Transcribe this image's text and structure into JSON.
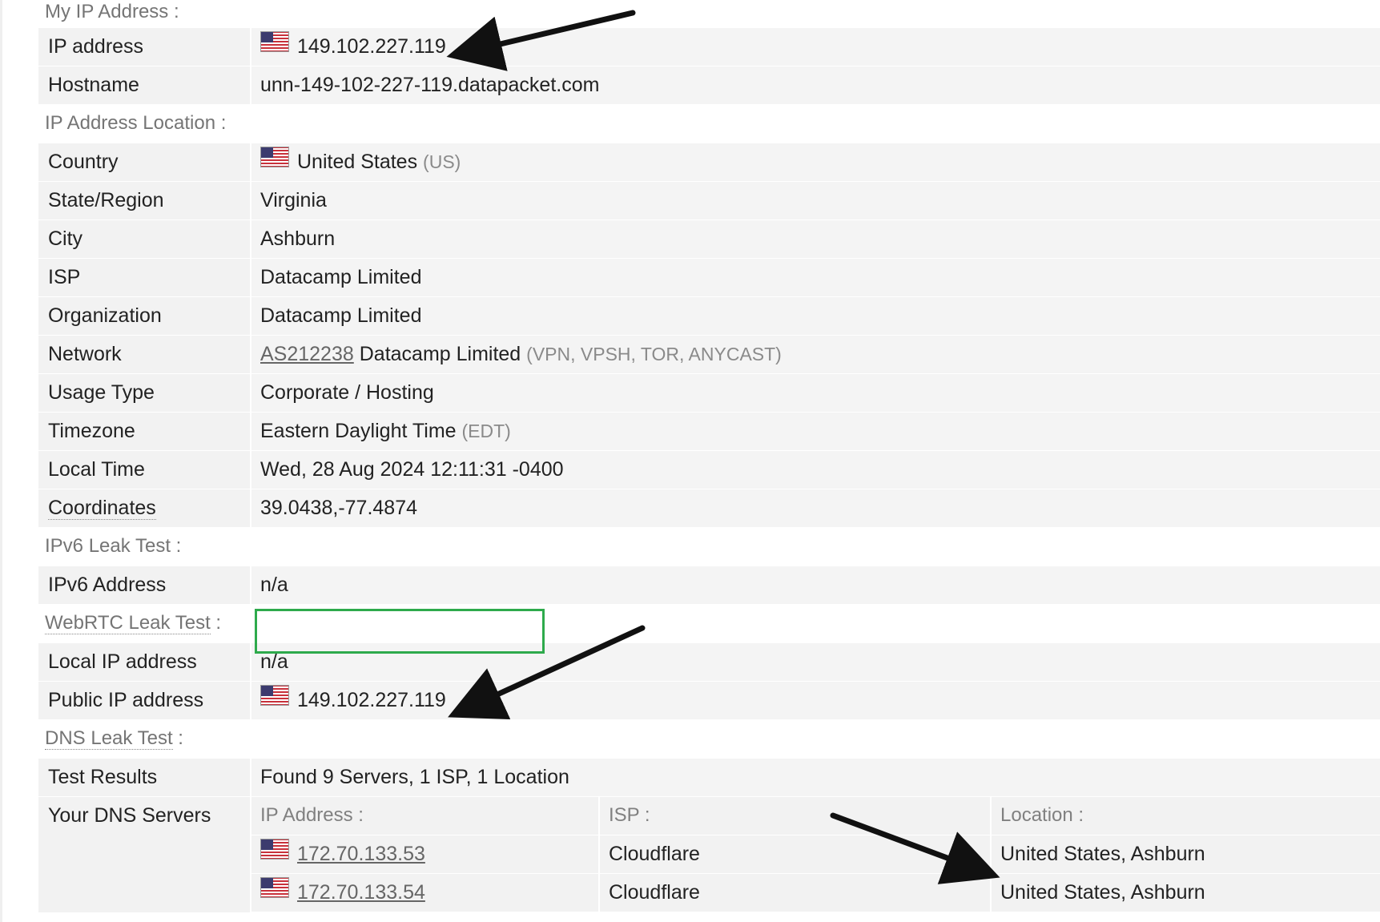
{
  "sections": {
    "my_ip": "My IP Address :",
    "location": "IP Address Location :",
    "ipv6": "IPv6 Leak Test :",
    "webrtc": "WebRTC Leak Test",
    "webrtc_colon": " :",
    "dns": "DNS Leak Test",
    "dns_colon": " :"
  },
  "my_ip": {
    "ip_label": "IP address",
    "ip_value": "149.102.227.119",
    "hostname_label": "Hostname",
    "hostname_value": "unn-149-102-227-119.datapacket.com"
  },
  "location": {
    "country_label": "Country",
    "country_value": "United States",
    "country_code": "(US)",
    "state_label": "State/Region",
    "state_value": "Virginia",
    "city_label": "City",
    "city_value": "Ashburn",
    "isp_label": "ISP",
    "isp_value": "Datacamp Limited",
    "org_label": "Organization",
    "org_value": "Datacamp Limited",
    "network_label": "Network",
    "network_asn": "AS212238",
    "network_name": "Datacamp Limited",
    "network_tags": "(VPN, VPSH, TOR, ANYCAST)",
    "usage_label": "Usage Type",
    "usage_value": "Corporate / Hosting",
    "tz_label": "Timezone",
    "tz_value": "Eastern Daylight Time",
    "tz_code": "(EDT)",
    "localtime_label": "Local Time",
    "localtime_value": "Wed, 28 Aug 2024 12:11:31 -0400",
    "coords_label": "Coordinates",
    "coords_value": "39.0438,-77.4874"
  },
  "ipv6": {
    "addr_label": "IPv6 Address",
    "addr_value": "n/a"
  },
  "webrtc": {
    "local_label": "Local IP address",
    "local_value": "n/a",
    "public_label": "Public IP address",
    "public_value": "149.102.227.119"
  },
  "dns": {
    "results_label": "Test Results",
    "results_value": "Found 9 Servers, 1 ISP, 1 Location",
    "servers_label": "Your DNS Servers",
    "col_ip": "IP Address :",
    "col_isp": "ISP :",
    "col_location": "Location :",
    "rows": [
      {
        "ip": "172.70.133.53",
        "isp": "Cloudflare",
        "location": "United States, Ashburn"
      },
      {
        "ip": "172.70.133.54",
        "isp": "Cloudflare",
        "location": "United States, Ashburn"
      }
    ]
  },
  "icons": {
    "flag": "us-flag-icon",
    "arrow": "annotation-arrow"
  },
  "colors": {
    "highlight_box": "#2eaa4c",
    "row_bg": "#f2f2f2",
    "muted_text": "#8a8a8a",
    "arrow": "#111111"
  }
}
